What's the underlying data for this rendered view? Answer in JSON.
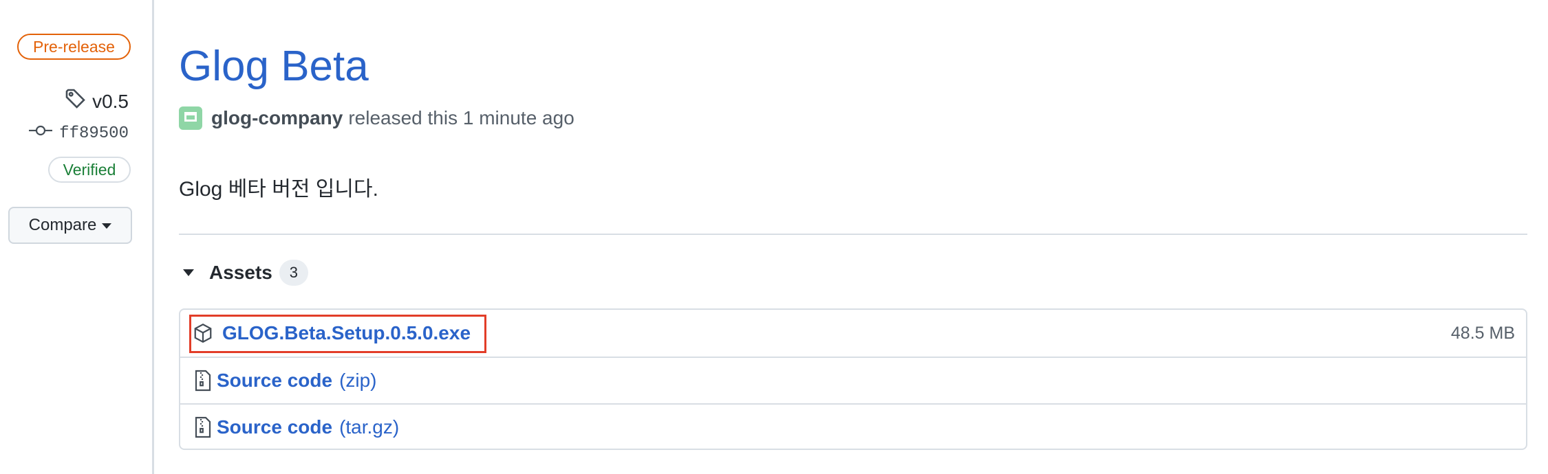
{
  "sidebar": {
    "badge": "Pre-release",
    "tag": "v0.5",
    "commit": "ff89500",
    "verified": "Verified",
    "compare": "Compare"
  },
  "release": {
    "title": "Glog Beta",
    "author": "glog-company",
    "released_text": "released this 1 minute ago",
    "description": "Glog 베타 버전 입니다."
  },
  "assets": {
    "label": "Assets",
    "count": "3",
    "items": [
      {
        "name": "GLOG.Beta.Setup.0.5.0.exe",
        "size": "48.5 MB",
        "icon": "package-icon"
      },
      {
        "name": "Source code",
        "sub": "(zip)",
        "icon": "file-zip-icon"
      },
      {
        "name": "Source code",
        "sub": "(tar.gz)",
        "icon": "file-zip-icon"
      }
    ]
  },
  "colors": {
    "link": "#2a63c9",
    "prerelease": "#e36209",
    "verified": "#1a7f37",
    "highlight": "#e23d28"
  }
}
